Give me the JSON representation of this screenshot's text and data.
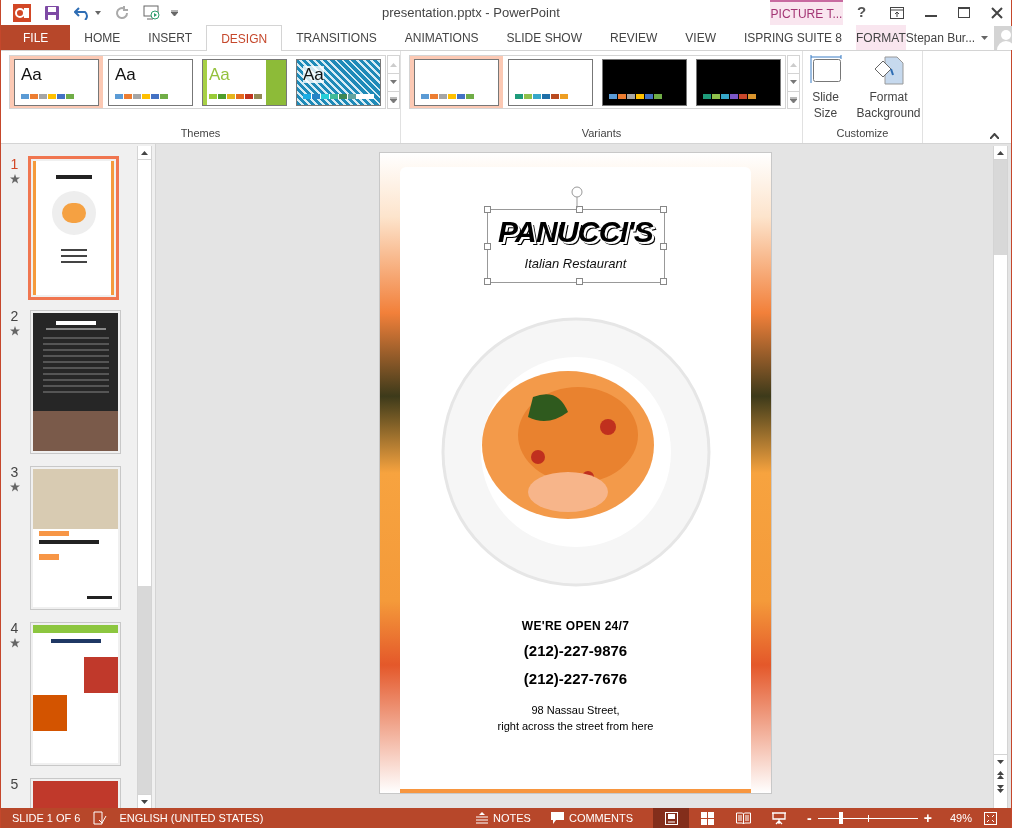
{
  "window": {
    "title": "presentation.pptx - PowerPoint",
    "contextual_group": "PICTURE T...",
    "help": "?",
    "user": "Stepan Bur..."
  },
  "ribbon_tabs": [
    {
      "label": "FILE",
      "kind": "file",
      "selected": false
    },
    {
      "label": "HOME",
      "kind": "normal",
      "selected": false
    },
    {
      "label": "INSERT",
      "kind": "normal",
      "selected": false
    },
    {
      "label": "DESIGN",
      "kind": "normal",
      "selected": true
    },
    {
      "label": "TRANSITIONS",
      "kind": "normal",
      "selected": false
    },
    {
      "label": "ANIMATIONS",
      "kind": "normal",
      "selected": false
    },
    {
      "label": "SLIDE SHOW",
      "kind": "normal",
      "selected": false
    },
    {
      "label": "REVIEW",
      "kind": "normal",
      "selected": false
    },
    {
      "label": "VIEW",
      "kind": "normal",
      "selected": false
    },
    {
      "label": "ISPRING SUITE 8",
      "kind": "normal",
      "selected": false
    },
    {
      "label": "FORMAT",
      "kind": "contextual",
      "selected": false
    }
  ],
  "themes": {
    "label": "Themes",
    "items": [
      {
        "label": "Aa",
        "kind": "plain",
        "selected": true,
        "swatches": [
          {
            "color": "#5b9bd5"
          },
          {
            "color": "#ed7d31"
          },
          {
            "color": "#a5a5a5"
          },
          {
            "color": "#ffc000"
          },
          {
            "color": "#4472c4"
          },
          {
            "color": "#70ad47"
          }
        ]
      },
      {
        "label": "Aa",
        "kind": "plain",
        "selected": false,
        "swatches": [
          {
            "color": "#5b9bd5"
          },
          {
            "color": "#ed7d31"
          },
          {
            "color": "#a5a5a5"
          },
          {
            "color": "#ffc000"
          },
          {
            "color": "#4472c4"
          },
          {
            "color": "#70ad47"
          }
        ]
      },
      {
        "label": "Aa",
        "kind": "green",
        "selected": false,
        "swatches": [
          {
            "color": "#99cb38"
          },
          {
            "color": "#4e9e2a"
          },
          {
            "color": "#e5b51d"
          },
          {
            "color": "#e56a1e"
          },
          {
            "color": "#c1321d"
          },
          {
            "color": "#938953"
          }
        ]
      },
      {
        "label": "Aa",
        "kind": "pattern",
        "selected": false,
        "swatches": [
          {
            "color": "#1cade4"
          },
          {
            "color": "#2683c6"
          },
          {
            "color": "#27ced7"
          },
          {
            "color": "#42ba97"
          },
          {
            "color": "#3e8853"
          },
          {
            "color": "#62a39f"
          }
        ]
      }
    ]
  },
  "variants": {
    "label": "Variants",
    "items": [
      {
        "dark": false,
        "selected": true,
        "swatches": [
          {
            "color": "#5b9bd5"
          },
          {
            "color": "#ed7d31"
          },
          {
            "color": "#a5a5a5"
          },
          {
            "color": "#ffc000"
          },
          {
            "color": "#4472c4"
          },
          {
            "color": "#70ad47"
          }
        ]
      },
      {
        "dark": false,
        "selected": false,
        "swatches": [
          {
            "color": "#1e9b7b"
          },
          {
            "color": "#8fc04b"
          },
          {
            "color": "#36a7c9"
          },
          {
            "color": "#1e6fa8"
          },
          {
            "color": "#b94a1f"
          },
          {
            "color": "#ee9e22"
          }
        ]
      },
      {
        "dark": true,
        "selected": false,
        "swatches": [
          {
            "color": "#5b9bd5"
          },
          {
            "color": "#ed7d31"
          },
          {
            "color": "#a5a5a5"
          },
          {
            "color": "#ffc000"
          },
          {
            "color": "#4472c4"
          },
          {
            "color": "#70ad47"
          }
        ]
      },
      {
        "dark": true,
        "selected": false,
        "swatches": [
          {
            "color": "#1e9b7b"
          },
          {
            "color": "#8fc04b"
          },
          {
            "color": "#36a7c9"
          },
          {
            "color": "#7b57c6"
          },
          {
            "color": "#c8462b"
          },
          {
            "color": "#d9942d"
          }
        ]
      }
    ]
  },
  "customize": {
    "label": "Customize",
    "slide_size": "Slide Size",
    "format_background": "Format Background"
  },
  "slides": [
    {
      "number": "1",
      "kind": "light",
      "selected": true,
      "animated": true
    },
    {
      "number": "2",
      "kind": "dark",
      "selected": false,
      "animated": true
    },
    {
      "number": "3",
      "kind": "photo",
      "selected": false,
      "animated": true
    },
    {
      "number": "4",
      "kind": "green",
      "selected": false,
      "animated": true
    },
    {
      "number": "5",
      "kind": "red",
      "selected": false,
      "animated": false
    }
  ],
  "slide": {
    "title": "PANUCCI'S",
    "subtitle": "Italian Restaurant",
    "title_selected": true,
    "hours": "WE'RE OPEN 24/7",
    "phones": [
      "(212)-227-9876",
      "(212)-227-7676"
    ],
    "address": [
      "98 Nassau Street,",
      "right across the street from here"
    ]
  },
  "status_bar": {
    "slide_info": "SLIDE 1 OF 6",
    "language": "ENGLISH (UNITED STATES)",
    "notes": "NOTES",
    "comments": "COMMENTS",
    "views": [
      {
        "kind": "normal",
        "selected": true
      },
      {
        "kind": "sorter",
        "selected": false
      },
      {
        "kind": "reading",
        "selected": false
      },
      {
        "kind": "slideshow",
        "selected": false
      }
    ],
    "zoom_minus": "-",
    "zoom_plus": "+",
    "zoom": {
      "level": 0.22
    },
    "zoom_reading": "49%"
  }
}
